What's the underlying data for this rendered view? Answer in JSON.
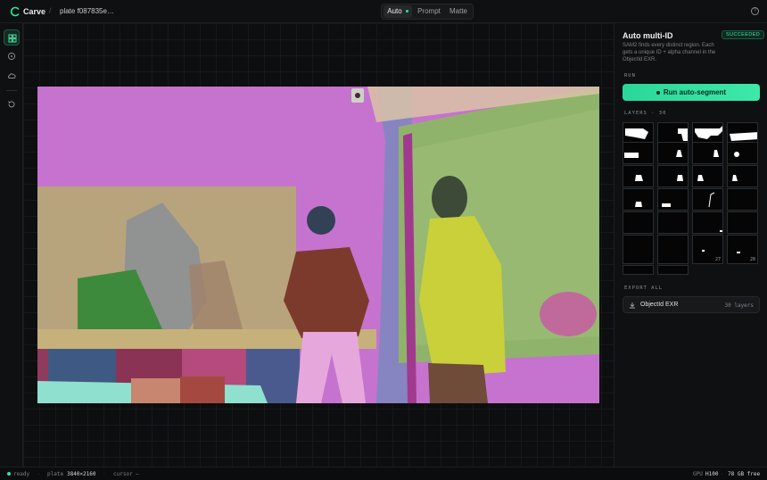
{
  "app": {
    "brand": "Carve",
    "breadcrumb_sep": "/",
    "plate_name": "plate f087835e…"
  },
  "modes": [
    {
      "label": "Auto",
      "active": true
    },
    {
      "label": "Prompt",
      "active": false
    },
    {
      "label": "Matte",
      "active": false
    }
  ],
  "rail": {
    "items": [
      "layers-icon",
      "target-icon",
      "cloud-icon",
      "history-icon"
    ]
  },
  "panel": {
    "title": "Auto multi-ID",
    "status_badge": "SUCCEEDED",
    "description": "SAM2 finds every distinct region. Each gets a unique ID + alpha channel in the ObjectId EXR.",
    "run_section": "RUN",
    "run_button": "Run auto-segment",
    "layers_section": "LAYERS · 30",
    "layer_numbers": {
      "27": "27",
      "28": "28"
    },
    "export_section": "EXPORT ALL",
    "export_label": "ObjectId EXR",
    "export_count": "30 layers"
  },
  "status": {
    "state": "ready",
    "plate_label": "plate",
    "plate_value": "3840×2160",
    "cursor_label": "cursor",
    "cursor_value": "—",
    "gpu_label": "GPU",
    "gpu_value": "H100",
    "disk": "78 GB free"
  },
  "colors": {
    "accent": "#2ee59d",
    "seg_wall": "#c573cf",
    "seg_glass": "#8fb36a",
    "seg_person_right": "#c9d03a",
    "seg_shirt": "#7c3a2c",
    "seg_pants": "#e6a8dc"
  }
}
